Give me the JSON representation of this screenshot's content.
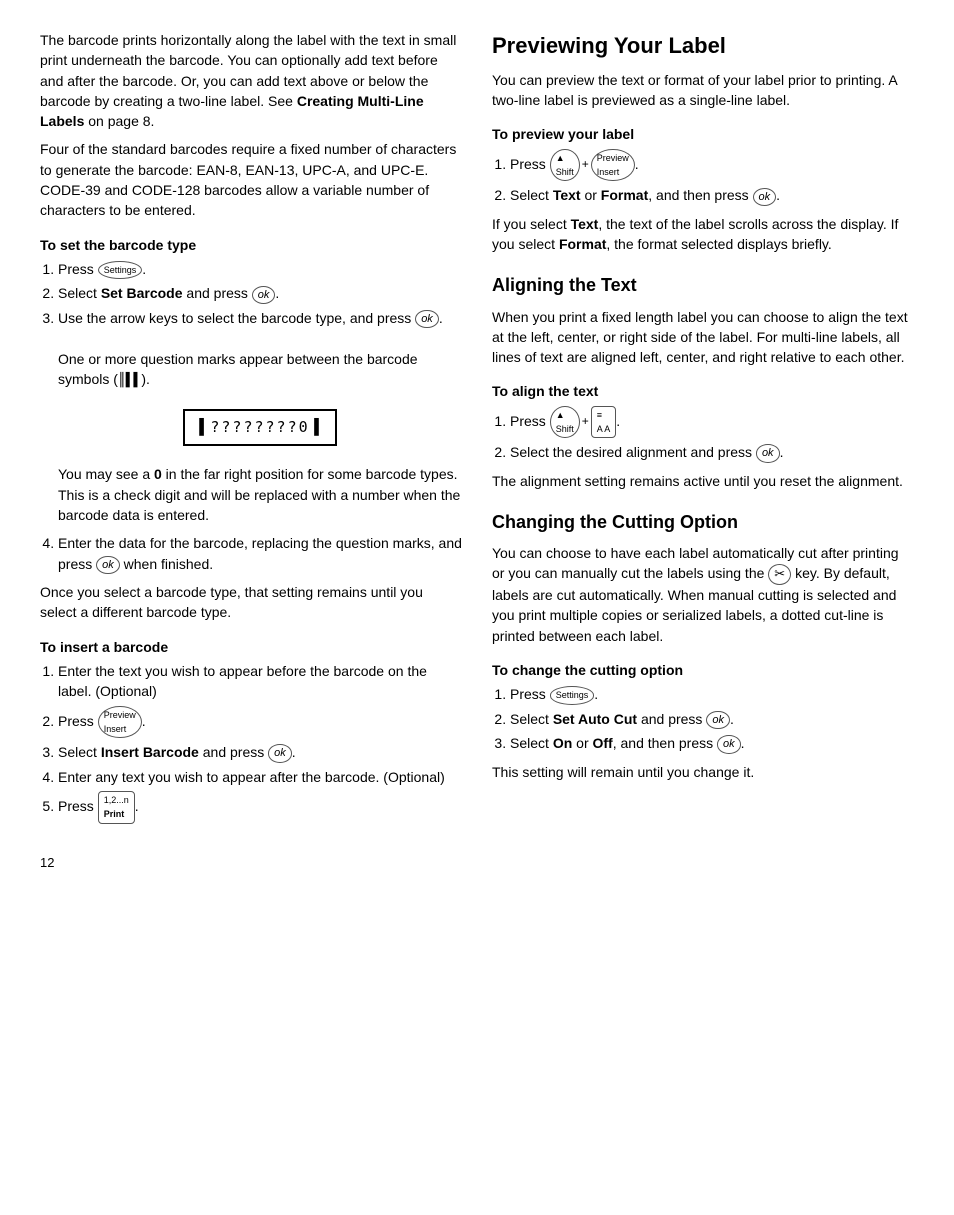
{
  "left": {
    "intro_para1": "The barcode prints horizontally along the label with the text in small print underneath the barcode. You can optionally add text before and after the barcode. Or, you can add text above or below the barcode by creating a two-line label. See ",
    "intro_bold1": "Creating Multi-Line Labels",
    "intro_para1_end": " on page 8.",
    "intro_para2": "Four of the standard barcodes require a fixed number of characters to generate the barcode: EAN-8, EAN-13, UPC-A, and UPC-E. CODE-39 and CODE-128 barcodes allow a variable number of characters to be entered.",
    "set_barcode_heading": "To set the barcode type",
    "set_barcode_steps": [
      {
        "text": "Press ",
        "btn": "Settings"
      },
      {
        "text": "Select ",
        "bold": "Set Barcode",
        "after": " and press ",
        "btn": "ok"
      },
      {
        "text": "Use the arrow keys to select the barcode type, and press ",
        "btn": "ok",
        "extra": "One or more question marks appear between the barcode symbols (|||)."
      }
    ],
    "barcode_display": "|||????????0|||",
    "barcode_note": "You may see a ",
    "barcode_note_bold": "0",
    "barcode_note_end": " in the far right position for some barcode types. This is a check digit and will be replaced with a number when the barcode data is entered.",
    "step4": {
      "text": "Enter the data for the barcode, replacing the question marks, and press ",
      "btn": "ok",
      "after": " when finished."
    },
    "once_para": "Once you select a barcode type, that setting remains until you select a different barcode type.",
    "insert_barcode_heading": "To insert a barcode",
    "insert_steps": [
      {
        "text": "Enter the text you wish to appear before the barcode on the label. (Optional)"
      },
      {
        "text": "Press ",
        "btn": "Preview/Insert"
      },
      {
        "text": "Select ",
        "bold": "Insert Barcode",
        "after": " and press ",
        "btn": "ok"
      },
      {
        "text": "Enter any text you wish to appear after the barcode. (Optional)"
      },
      {
        "text": "Press ",
        "btn": "Print"
      }
    ],
    "page_num": "12"
  },
  "right": {
    "preview_title": "Previewing Your Label",
    "preview_para": "You can preview the text or format of your label prior to printing. A two-line label is previewed as a single-line label.",
    "preview_subhead": "To preview your label",
    "preview_steps": [
      {
        "text": "Press ",
        "combo": [
          "Shift",
          "Preview/Insert"
        ]
      },
      {
        "text": "Select ",
        "bold": "Text",
        "mid": " or ",
        "bold2": "Format",
        "after": ", and then press ",
        "btn": "ok"
      }
    ],
    "preview_note1": "If you select ",
    "preview_note1_bold": "Text",
    "preview_note1_end": ", the text of the label scrolls across the display. If you select ",
    "preview_note2_bold": "Format",
    "preview_note2_end": ", the format selected displays briefly.",
    "align_title": "Aligning the Text",
    "align_para": "When you print a fixed length label you can choose to align the text at the left, center, or right side of the label. For multi-line labels, all lines of text are aligned left, center, and right relative to each other.",
    "align_subhead": "To align the text",
    "align_steps": [
      {
        "text": "Press ",
        "combo": [
          "Shift",
          "Align"
        ]
      },
      {
        "text": "Select the desired alignment and press ",
        "btn": "ok"
      }
    ],
    "align_note": "The alignment setting remains active until you reset the alignment.",
    "cutting_title": "Changing the Cutting Option",
    "cutting_para": "You can choose to have each label automatically cut after printing or you can manually cut the labels using the ",
    "cutting_para_btn": "scissors",
    "cutting_para_end": " key. By default, labels are cut automatically. When manual cutting is selected and you print multiple copies or serialized labels, a dotted cut-line is printed between each label.",
    "cutting_subhead": "To change the cutting option",
    "cutting_steps": [
      {
        "text": "Press ",
        "btn": "Settings"
      },
      {
        "text": "Select ",
        "bold": "Set Auto Cut",
        "after": " and press ",
        "btn": "ok"
      },
      {
        "text": "Select ",
        "bold": "On",
        "mid": " or ",
        "bold2": "Off",
        "after": ", and then press ",
        "btn": "ok"
      }
    ],
    "cutting_note": "This setting will remain until you change it."
  }
}
